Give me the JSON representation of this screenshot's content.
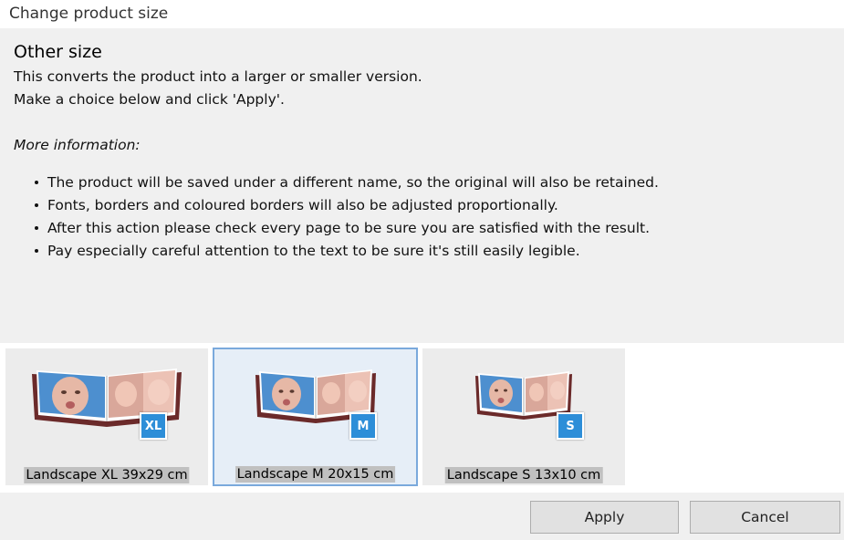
{
  "window": {
    "title": "Change product size"
  },
  "info": {
    "heading": "Other size",
    "description_line1": "This converts the product into a larger or smaller version.",
    "description_line2": "Make a choice below and click 'Apply'.",
    "more_info_label": "More information:",
    "bullets": [
      "The product will be saved under a different name, so the original will also be retained.",
      "Fonts, borders and coloured borders will also be adjusted proportionally.",
      "After this action please check every page to be sure you are satisfied with the result.",
      "Pay especially careful attention to the text to be sure it's still easily legible."
    ]
  },
  "options": [
    {
      "badge": "XL",
      "label": "Landscape XL 39x29 cm",
      "selected": false
    },
    {
      "badge": "M",
      "label": "Landscape M 20x15 cm",
      "selected": true
    },
    {
      "badge": "S",
      "label": "Landscape S 13x10 cm",
      "selected": false
    }
  ],
  "buttons": {
    "apply": "Apply",
    "cancel": "Cancel"
  },
  "colors": {
    "accent": "#2d8ed8",
    "selected_border": "#7aa9dc",
    "panel_bg": "#f0f0f0"
  }
}
